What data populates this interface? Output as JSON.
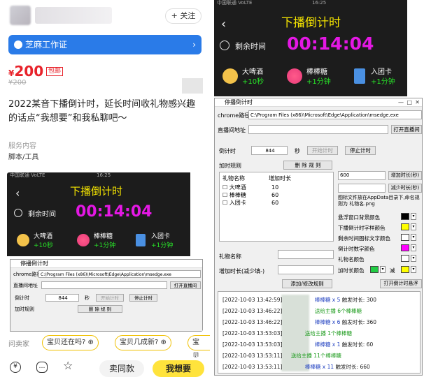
{
  "listing": {
    "follow_label": "+ 关注",
    "zhima_label": "芝麻工作证",
    "zhima_chevron": "›",
    "currency": "¥",
    "price": "200",
    "baoyou": "包邮",
    "old_price": "¥200",
    "description": "2022某音下播倒计时，延长时间收礼物感兴趣的话点“我想要”和我私聊吧～",
    "service_label": "服务内容",
    "service_value": "脚本/工具",
    "ask_label": "问卖家",
    "chips": [
      "宝贝还在吗? ⊕",
      "宝贝几成新? ⊕",
      "宝贝"
    ],
    "sell_same": "卖同款",
    "want": "我想要"
  },
  "timer": {
    "status_left": "中国联通 VoLTE",
    "status_time": "16:25",
    "title": "下播倒计时",
    "remaining_label": "剩余时间",
    "time": "00:14:04",
    "gifts": [
      {
        "name": "大啤酒",
        "bonus": "+10秒"
      },
      {
        "name": "棒棒糖",
        "bonus": "+1分钟"
      },
      {
        "name": "入团卡",
        "bonus": "+1分钟"
      }
    ]
  },
  "settings": {
    "window_title": "停播倒计时",
    "chrome_label": "chrome路径",
    "chrome_path": "C:\\Program Files (x86)\\Microsoft\\Edge\\Application\\msedge.exe",
    "live_url_label": "直播间地址",
    "open_live": "打开直播间",
    "countdown_label": "倒计时",
    "countdown_value": "844",
    "sec_label": "秒",
    "start_btn": "开始计时",
    "stop_btn": "停止计时",
    "rules_label": "加时规则",
    "delete_rule": "删 除 规 则",
    "col_gift": "礼物名称",
    "col_add": "增加时长",
    "rules": [
      {
        "name": "大啤酒",
        "add": "10"
      },
      {
        "name": "棒棒糖",
        "add": "60"
      },
      {
        "name": "入团卡",
        "add": "60"
      }
    ],
    "inc_value": "600",
    "inc_btn": "增加时长(秒)",
    "dec_btn": "减少时长(秒)",
    "note": "图标文件放在AppData目录下,命名规则为 礼物名.png",
    "colors": [
      {
        "label": "悬浮窗口背景颜色",
        "color": "#000000"
      },
      {
        "label": "下播倒计时字样颜色",
        "color": "#ffff00"
      },
      {
        "label": "剩余时间图标文字颜色",
        "color": "#ffffff"
      },
      {
        "label": "倒计时数字颜色",
        "color": "#ff00ff"
      },
      {
        "label": "礼物名颜色",
        "color": "#ffffff"
      }
    ],
    "addtime_color_label": "加时长颜色",
    "addtime_color": "#22cc44",
    "minus_label": "减",
    "minus_color": "#ffff00",
    "gift_name_label": "礼物名称",
    "add_dur_label": "增加时长(减少填-)",
    "add_rule_btn": "添加/修改规则",
    "open_timer_btn": "打开倒计时悬浮",
    "log": [
      {
        "time": "[2022-10-03 13:42:59]",
        "gift": "棒棒糖 x 5",
        "tail": "触发时长: 300"
      },
      {
        "time": "[2022-10-03 13:46:22]",
        "gift": "送给主播 6个棒棒糖",
        "tail": ""
      },
      {
        "time": "[2022-10-03 13:46:22]",
        "gift": "棒棒糖 x 6",
        "tail": "触发时长: 360"
      },
      {
        "time": "[2022-10-03 13:53:03]",
        "gift": "送给主播 1个棒棒糖",
        "tail": ""
      },
      {
        "time": "[2022-10-03 13:53:03]",
        "gift": "棒棒糖 x 1",
        "tail": "触发时长: 60"
      },
      {
        "time": "[2022-10-03 13:53:11]",
        "gift": "送给主播 11个棒棒糖",
        "tail": ""
      },
      {
        "time": "[2022-10-03 13:53:11]",
        "gift": "棒棒糖 x 11",
        "tail": "触发时长: 660"
      }
    ]
  }
}
